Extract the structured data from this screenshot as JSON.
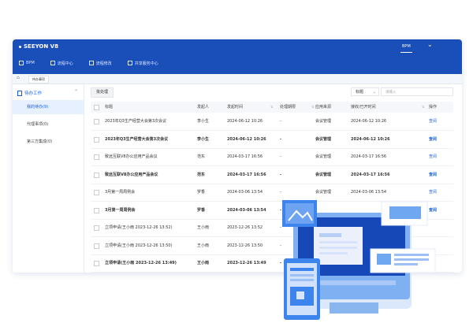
{
  "brand": "SEEYON V8",
  "topbar": {
    "right_label": "BPM"
  },
  "nav": [
    {
      "label": "BPM"
    },
    {
      "label": "流程中心"
    },
    {
      "label": "流程修改"
    },
    {
      "label": "共享服务中心"
    }
  ],
  "breadcrumb": {
    "tab": "待办事项"
  },
  "sidebar": {
    "header": "待办工作",
    "items": [
      {
        "label": "我的待办(9)"
      },
      {
        "label": "代理事项(0)"
      },
      {
        "label": "第三方集成(0)"
      }
    ]
  },
  "toolbar": {
    "batch_label": "批处理",
    "filter_value": "标题",
    "search_placeholder": "请输入"
  },
  "table": {
    "columns": [
      "标题",
      "发起人",
      "发起时间",
      "处理期限",
      "应用来源",
      "接收/已开时间",
      "操作"
    ],
    "rows": [
      {
        "title": "2023年Q3生产经营大会第3次会议",
        "sender": "李小生",
        "start": "2024-06-12 10:26",
        "deadline": "-",
        "source": "会议管理",
        "received": "2024-06-12 10:26",
        "action": "查阅",
        "bold": false
      },
      {
        "title": "2023年Q3生产经营大会第3次会议",
        "sender": "李小生",
        "start": "2024-06-12 10:26",
        "deadline": "-",
        "source": "会议管理",
        "received": "2024-06-12 10:26",
        "action": "查阅",
        "bold": true
      },
      {
        "title": "致远互联V8办公应用产品会议",
        "sender": "范东",
        "start": "2024-03-17 16:56",
        "deadline": "-",
        "source": "会议管理",
        "received": "2024-03-17 16:56",
        "action": "查阅",
        "bold": false
      },
      {
        "title": "致远互联V8办公应用产品会议",
        "sender": "范东",
        "start": "2024-03-17 16:56",
        "deadline": "-",
        "source": "会议管理",
        "received": "2024-03-17 16:56",
        "action": "查阅",
        "bold": true
      },
      {
        "title": "3月第一周周例会",
        "sender": "罗香",
        "start": "2024-03-06 13:54",
        "deadline": "-",
        "source": "会议管理",
        "received": "2024-03-06 13:54",
        "action": "查阅",
        "bold": false
      },
      {
        "title": "3月第一周周例会",
        "sender": "罗香",
        "start": "2024-03-06 13:54",
        "deadline": "-",
        "source": "",
        "received": "",
        "action": "查阅",
        "bold": true
      },
      {
        "title": "立项申请(王小雨 2023-12-26 13:52)",
        "sender": "王小雨",
        "start": "2023-12-26 13:52",
        "deadline": "-",
        "source": "",
        "received": "",
        "action": "",
        "bold": false
      },
      {
        "title": "立项申请(王小雨 2023-12-26 13:50)",
        "sender": "王小雨",
        "start": "2023-12-26 13:50",
        "deadline": "-",
        "source": "",
        "received": "",
        "action": "",
        "bold": false
      },
      {
        "title": "立项申请(王小雨 2023-12-26 13:49)",
        "sender": "王小雨",
        "start": "2023-12-26 13:49",
        "deadline": "-",
        "source": "",
        "received": "",
        "action": "",
        "bold": true
      }
    ]
  },
  "colors": {
    "primary": "#1a4fb9",
    "link": "#1a6be0",
    "active_bg": "#e6f0ff"
  },
  "icons": [
    "home-icon",
    "todo-icon",
    "chevron-down-icon",
    "sort-icon",
    "image-icon",
    "monitor-icon"
  ]
}
